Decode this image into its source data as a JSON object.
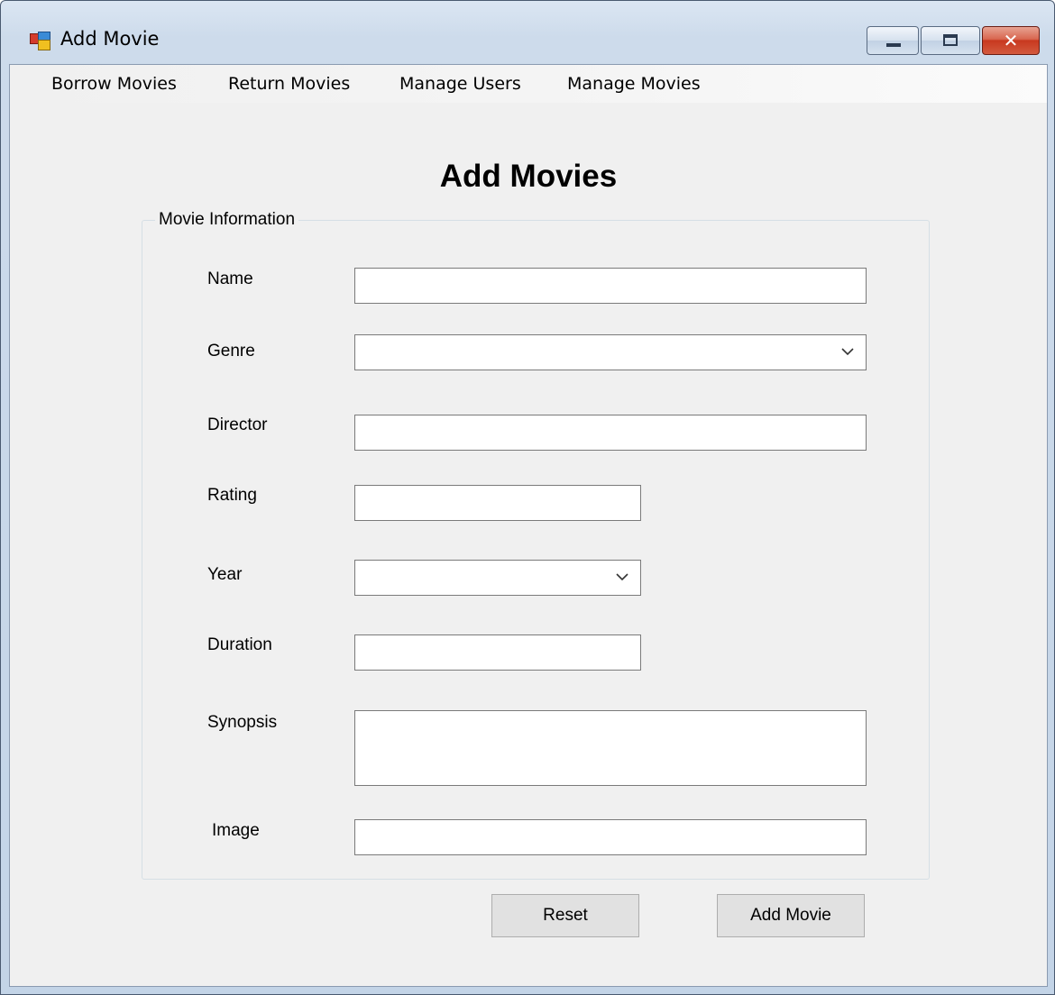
{
  "window": {
    "title": "Add Movie",
    "close_glyph": "✕"
  },
  "menu": {
    "items": [
      "Borrow Movies",
      "Return Movies",
      "Manage Users",
      "Manage Movies"
    ]
  },
  "form": {
    "heading": "Add Movies",
    "group_title": "Movie Information",
    "fields": {
      "name": {
        "label": "Name",
        "value": ""
      },
      "genre": {
        "label": "Genre",
        "value": ""
      },
      "director": {
        "label": "Director",
        "value": ""
      },
      "rating": {
        "label": "Rating",
        "value": ""
      },
      "year": {
        "label": "Year",
        "value": ""
      },
      "duration": {
        "label": "Duration",
        "value": ""
      },
      "synopsis": {
        "label": "Synopsis",
        "value": ""
      },
      "image": {
        "label": "Image",
        "value": ""
      }
    },
    "buttons": {
      "reset": "Reset",
      "add_movie": "Add Movie"
    }
  },
  "icons": {
    "app": "app-form-icon",
    "minimize": "minimize-icon",
    "maximize": "maximize-icon",
    "close": "close-icon",
    "dropdown": "chevron-down-icon"
  }
}
